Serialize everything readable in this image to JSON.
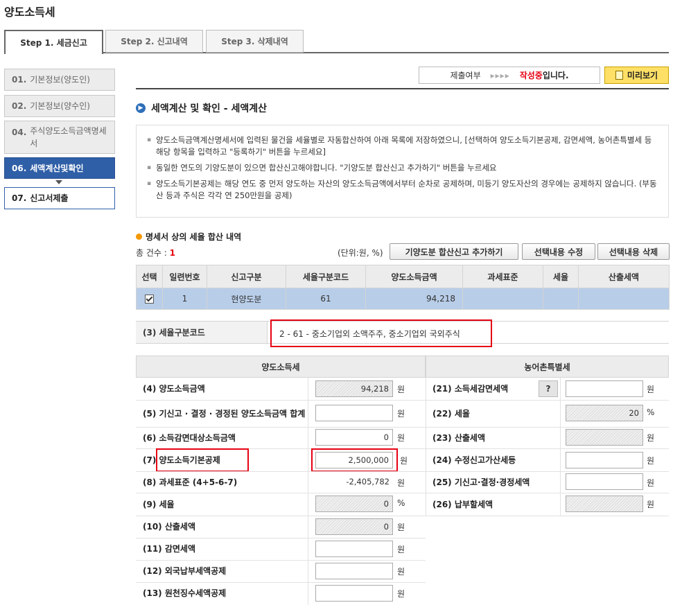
{
  "page_title": "양도소득세",
  "tabs": [
    {
      "label": "Step 1. 세금신고",
      "active": true
    },
    {
      "label": "Step 2. 신고내역",
      "active": false
    },
    {
      "label": "Step 3. 삭제내역",
      "active": false
    }
  ],
  "steps": [
    {
      "num": "01.",
      "label": "기본정보(양도인)",
      "state": "inactive"
    },
    {
      "num": "02.",
      "label": "기본정보(양수인)",
      "state": "inactive"
    },
    {
      "num": "04.",
      "label": "주식양도소득금액명세서",
      "state": "inactive"
    },
    {
      "num": "06.",
      "label": "세액계산및확인",
      "state": "active"
    },
    {
      "num": "07.",
      "label": "신고서제출",
      "state": "next"
    }
  ],
  "status": {
    "label": "제출여부",
    "arrows": "▸▸▸▸",
    "highlight": "작성중",
    "tail": "입니다."
  },
  "preview_button": "미리보기",
  "section_title": "세액계산 및 확인 - 세액계산",
  "notices": [
    "양도소득금액계산명세서에 입력된 물건을 세율별로 자동합산하여 아래 목록에 저장하였으니, [선택하여 양도소득기본공제, 감면세액, 농어촌특별세 등 해당 항목을 입력하고 \"등록하기\" 버튼을 누르세요]",
    "동일한 연도의 기양도분이 있으면 합산신고해야합니다. \"기양도분 합산신고 추가하기\" 버튼을 누르세요",
    "양도소득기본공제는 해당 연도 중 먼저 양도하는 자산의 양도소득금액에서부터 순차로 공제하며, 미등기 양도자산의 경우에는 공제하지 않습니다. (부동산 등과 주식은 각각 연 250만원을 공제)"
  ],
  "summary": {
    "title": "명세서 상의 세율 합산 내역",
    "count_label": "총 건수 : ",
    "count": "1",
    "unit": "(단위:원, %)",
    "buttons": {
      "add": "기양도분 합산신고 추가하기",
      "edit": "선택내용 수정",
      "delete": "선택내용 삭제"
    },
    "columns": [
      "선택",
      "일련번호",
      "신고구분",
      "세율구분코드",
      "양도소득금액",
      "과세표준",
      "세율",
      "산출세액"
    ],
    "rows": [
      {
        "serial": "1",
        "type": "현양도분",
        "code": "61",
        "amount": "94,218",
        "base": "",
        "rate": "",
        "tax": ""
      }
    ]
  },
  "tax_code": {
    "label": "(3) 세율구분코드",
    "value": "2 - 61 - 중소기업외 소액주주, 중소기업외 국외주식"
  },
  "left_section": {
    "title": "양도소득세",
    "rows": [
      {
        "label": "(4) 양도소득금액",
        "value": "94,218",
        "unit": "원",
        "disabled": true
      },
      {
        "label": "(5) 기신고 · 결정 · 경정된 양도소득금액 합계",
        "value": "",
        "unit": "원",
        "disabled": false
      },
      {
        "label": "(6) 소득감면대상소득금액",
        "value": "0",
        "unit": "원",
        "disabled": false
      },
      {
        "label": "(7) 양도소득기본공제",
        "value": "2,500,000",
        "unit": "원",
        "disabled": false
      },
      {
        "label": "(8) 과세표준 (4+5-6-7)",
        "value": "-2,405,782",
        "unit": "원",
        "disabled": false
      },
      {
        "label": "(9) 세율",
        "value": "0",
        "unit": "%",
        "disabled": true
      },
      {
        "label": "(10) 산출세액",
        "value": "0",
        "unit": "원",
        "disabled": true
      },
      {
        "label": "(11) 감면세액",
        "value": "",
        "unit": "원",
        "disabled": false
      },
      {
        "label": "(12) 외국납부세액공제",
        "value": "",
        "unit": "원",
        "disabled": false
      },
      {
        "label": "(13) 원천징수세액공제",
        "value": "",
        "unit": "원",
        "disabled": false
      }
    ]
  },
  "right_section": {
    "title": "농어촌특별세",
    "help_button": "?",
    "rows": [
      {
        "label": "(21) 소득세감면세액",
        "value": "",
        "unit": "원",
        "disabled": false
      },
      {
        "label": "(22) 세율",
        "value": "20",
        "unit": "%",
        "disabled": true
      },
      {
        "label": "(23) 산출세액",
        "value": "",
        "unit": "원",
        "disabled": true
      },
      {
        "label": "(24) 수정신고가산세등",
        "value": "",
        "unit": "원",
        "disabled": false
      },
      {
        "label": "(25) 기신고·결정·경정세액",
        "value": "",
        "unit": "원",
        "disabled": false
      },
      {
        "label": "(26) 납부할세액",
        "value": "",
        "unit": "원",
        "disabled": true
      }
    ]
  }
}
